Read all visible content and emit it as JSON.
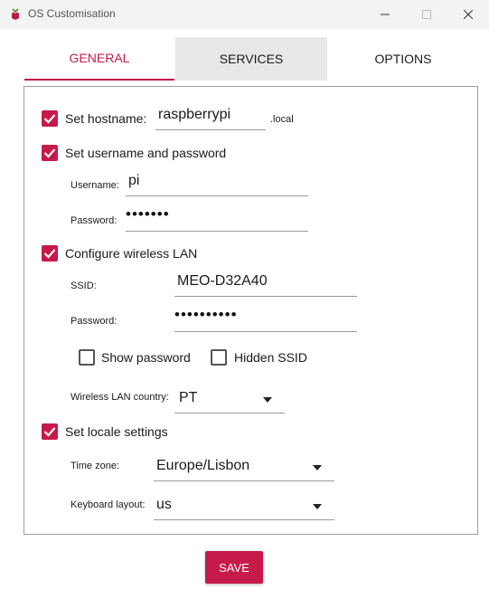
{
  "window": {
    "title": "OS Customisation"
  },
  "tabs": [
    {
      "label": "GENERAL"
    },
    {
      "label": "SERVICES"
    },
    {
      "label": "OPTIONS"
    }
  ],
  "general": {
    "hostname": {
      "label": "Set hostname:",
      "value": "raspberrypi",
      "suffix": ".local",
      "checked": true
    },
    "user": {
      "label": "Set username and password",
      "checked": true,
      "username_label": "Username:",
      "username": "pi",
      "password_label": "Password:",
      "password_mask": "•••••••"
    },
    "wlan": {
      "label": "Configure wireless LAN",
      "checked": true,
      "ssid_label": "SSID:",
      "ssid": "MEO-D32A40",
      "password_label": "Password:",
      "password_mask": "••••••••••",
      "show_password_label": "Show password",
      "show_password_checked": false,
      "hidden_ssid_label": "Hidden SSID",
      "hidden_ssid_checked": false,
      "country_label": "Wireless LAN country:",
      "country": "PT"
    },
    "locale": {
      "label": "Set locale settings",
      "checked": true,
      "timezone_label": "Time zone:",
      "timezone": "Europe/Lisbon",
      "keyboard_label": "Keyboard layout:",
      "keyboard": "us"
    }
  },
  "actions": {
    "save_label": "SAVE"
  },
  "colors": {
    "accent": "#c51a4a",
    "tab_inactive_bg": "#e8e8e8"
  }
}
